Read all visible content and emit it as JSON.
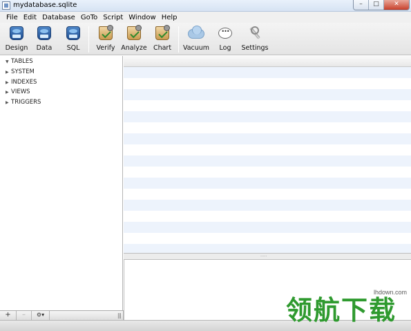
{
  "window": {
    "title": "mydatabase.sqlite",
    "buttons": [
      "–",
      "□",
      "✕"
    ]
  },
  "menu": [
    "File",
    "Edit",
    "Database",
    "GoTo",
    "Script",
    "Window",
    "Help"
  ],
  "toolbar": {
    "design": "Design",
    "data": "Data",
    "sql": "SQL",
    "verify": "Verify",
    "analyze": "Analyze",
    "chart": "Chart",
    "vacuum": "Vacuum",
    "log": "Log",
    "settings": "Settings"
  },
  "sidebar": {
    "tree": [
      "TABLES",
      "SYSTEM",
      "INDEXES",
      "VIEWS",
      "TRIGGERS"
    ],
    "footer": {
      "add": "+",
      "remove": "–",
      "gear": "⚙▾",
      "resize": "|||"
    }
  },
  "splitter_grip": "·····",
  "watermark": {
    "url": "lhdown.com",
    "logo": "领航下载"
  }
}
